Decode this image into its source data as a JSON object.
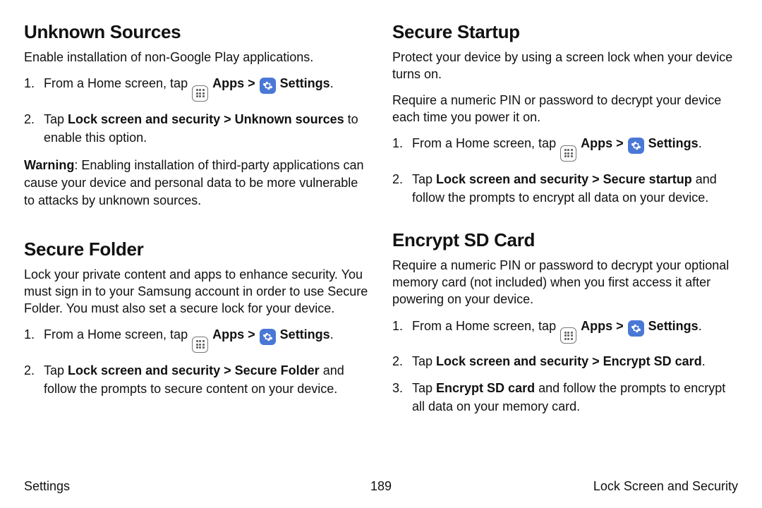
{
  "footer": {
    "left": "Settings",
    "page": "189",
    "right": "Lock Screen and Security"
  },
  "glyphs": {
    "apps": "Apps",
    "settings": "Settings",
    "chev": ">"
  },
  "step_prefix": "From a Home screen, tap",
  "left": {
    "unknown": {
      "title": "Unknown Sources",
      "desc": "Enable installation of non-Google Play applications.",
      "step2_bold": "Lock screen and security > Unknown sources",
      "step2_tail": " to enable this option.",
      "warn_label": "Warning",
      "warn_body": ": Enabling installation of third-party applications can cause your device and personal data to be more vulnerable to attacks by unknown sources."
    },
    "folder": {
      "title": "Secure Folder",
      "desc": "Lock your private content and apps to enhance security. You must sign in to your Samsung account in order to use Secure Folder. You must also set a secure lock for your device.",
      "step2_bold": "Lock screen and security > Secure Folder",
      "step2_tail": " and follow the prompts to secure content on your device."
    }
  },
  "right": {
    "startup": {
      "title": "Secure Startup",
      "desc1": "Protect your device by using a screen lock when your device turns on.",
      "desc2": "Require a numeric PIN or password to decrypt your device each time you power it on.",
      "step2_bold": "Lock screen and security > Secure startup",
      "step2_tail": " and follow the prompts to encrypt all data on your device."
    },
    "encrypt": {
      "title": "Encrypt SD Card",
      "desc": "Require a numeric PIN or password to decrypt your optional memory card (not included) when you first access it after powering on your device.",
      "step2_bold": "Lock screen and security > Encrypt SD card",
      "step3_bold": "Encrypt SD card",
      "step3_tail": " and follow the prompts to encrypt all data on your memory card."
    }
  },
  "tap": "Tap "
}
